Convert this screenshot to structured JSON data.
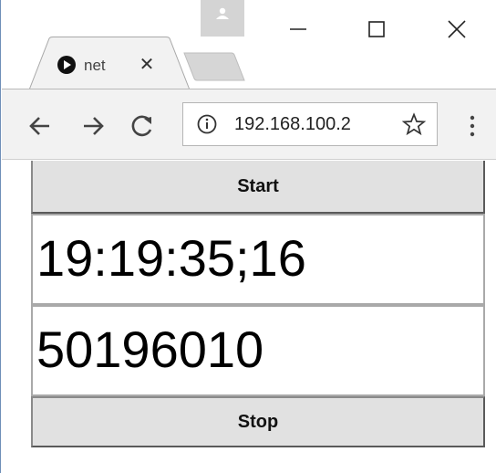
{
  "window": {
    "controls": {
      "minimize_icon": "minimize-icon",
      "maximize_icon": "maximize-icon",
      "close_icon": "close-icon"
    }
  },
  "tabs": [
    {
      "title": "net",
      "favicon": "play-circle-icon",
      "active": true
    }
  ],
  "toolbar": {
    "url": "192.168.100.2"
  },
  "page": {
    "start_label": "Start",
    "timecode_value": "19:19:35;16",
    "frames_value": "50196010",
    "stop_label": "Stop"
  },
  "colors": {
    "button_bg": "#e1e1e1",
    "toolbar_bg": "#f2f2f2",
    "profile_bg": "#d4d4d4"
  }
}
